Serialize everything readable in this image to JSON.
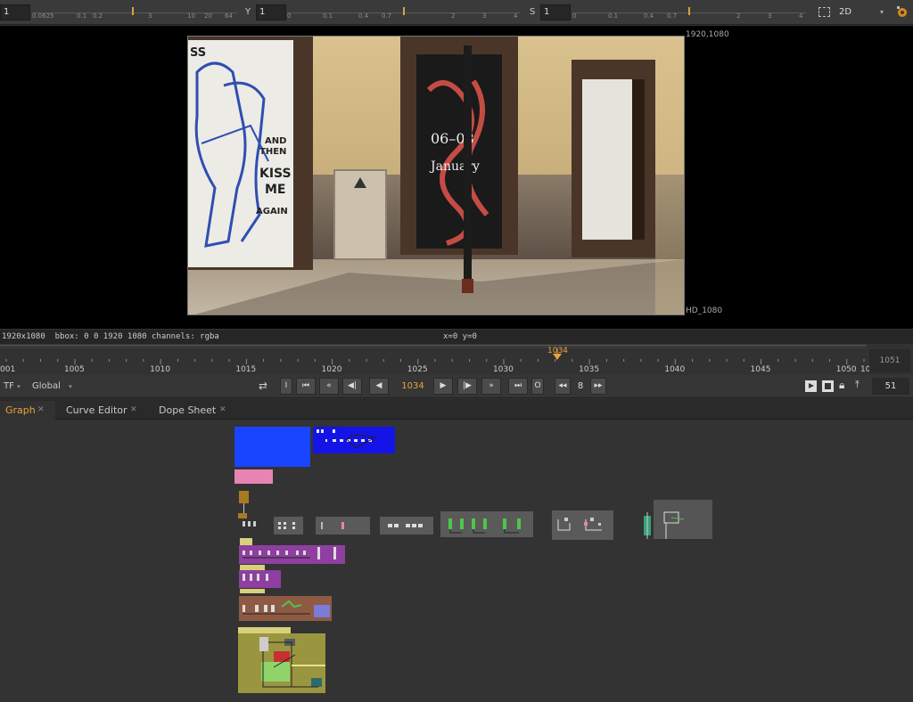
{
  "viewer_controls": {
    "gain_value": "1",
    "gain_ticks": [
      "0.0625",
      "0.1",
      "0.2",
      "1",
      "3",
      "10",
      "20",
      "64"
    ],
    "gamma_label": "Y",
    "gamma_value": "1",
    "gamma_ticks": [
      "0",
      "0.1",
      "0.4",
      "0.7",
      "1",
      "2",
      "3",
      "4"
    ],
    "saturation_label": "S",
    "saturation_value": "1",
    "saturation_ticks": [
      "0",
      "0.1",
      "0.4",
      "0.7",
      "1",
      "2",
      "3",
      "4"
    ],
    "view_mode": "2D"
  },
  "viewer": {
    "format_top_right": "1920,1080",
    "format_name": "HD_1080",
    "image_text": {
      "poster_left_top": "SS",
      "poster_and": "AND",
      "poster_then": "THEN",
      "poster_kiss": "KISS",
      "poster_me": "ME",
      "poster_again": "AGAIN",
      "poster_right_dates": "06–08",
      "poster_right_month": "January"
    }
  },
  "info_bar": {
    "format": "1920x1080",
    "bbox": "bbox: 0 0 1920 1080 channels: rgba",
    "cursor": "x=0 y=0"
  },
  "timeline": {
    "start_label": "001",
    "labels": [
      "1005",
      "1010",
      "1015",
      "1020",
      "1025",
      "1030",
      "1035",
      "1040",
      "1045",
      "1050",
      "1051"
    ],
    "current_frame": "1034",
    "end_frame": "1051"
  },
  "playback": {
    "fps_mode": "TF",
    "range_mode": "Global",
    "in_label": "I",
    "out_label": "O",
    "current_frame": "1034",
    "skip_value": "8",
    "last_frame": "51",
    "accent": "#e8a33a"
  },
  "tabs": [
    {
      "label": "Graph",
      "active": true
    },
    {
      "label": "Curve Editor",
      "active": false
    },
    {
      "label": "Dope Sheet",
      "active": false
    }
  ],
  "colors": {
    "background": "#323232",
    "viewer_bg": "#000000",
    "accent": "#e8a33a",
    "backdrop_blue": "#1a45ff",
    "backdrop_pink": "#e884b4",
    "backdrop_purple": "#8e3fa0",
    "backdrop_brown": "#8f5a44",
    "backdrop_olive": "#9a9640"
  }
}
